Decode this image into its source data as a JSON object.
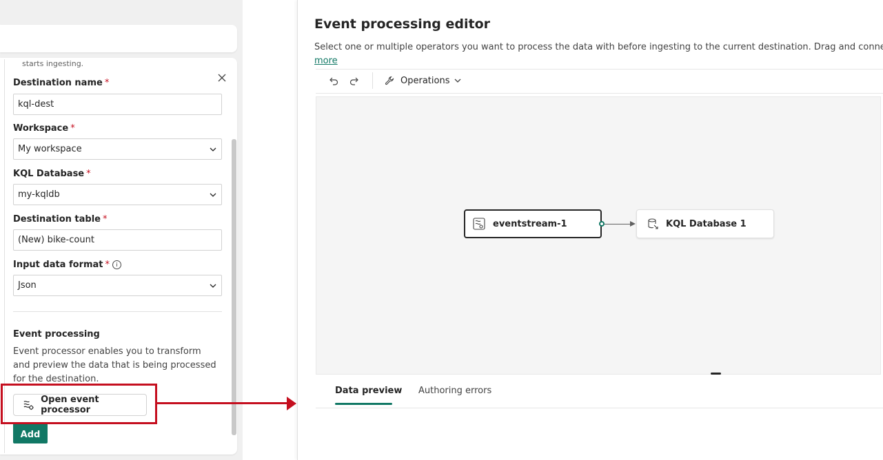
{
  "left_panel": {
    "ingest_text": "starts ingesting.",
    "fields": [
      {
        "label": "Destination name",
        "required": "*",
        "value": "kql-dest"
      },
      {
        "label": "Workspace",
        "required": "*",
        "value": "My workspace"
      },
      {
        "label": "KQL Database",
        "required": "*",
        "value": "my-kqldb"
      },
      {
        "label": "Destination table",
        "required": "*",
        "value": "(New) bike-count"
      },
      {
        "label": "Input data format",
        "required": "*",
        "value": "Json"
      }
    ],
    "info_glyph": "i",
    "event_processing": {
      "title": "Event processing",
      "description": "Event processor enables you to transform and preview the data that is being processed for the destination."
    },
    "open_button_label": "Open event processor",
    "add_button_label": "Add"
  },
  "editor": {
    "title": "Event processing editor",
    "description": "Select one or multiple operators you want to process the data with before ingesting to the current destination. Drag and connect the o",
    "more_link": "more",
    "toolbar": {
      "operations_label": "Operations"
    },
    "nodes": {
      "source": "eventstream-1",
      "destination": "KQL Database 1"
    },
    "tabs": [
      {
        "label": "Data preview",
        "active": true
      },
      {
        "label": "Authoring errors",
        "active": false
      }
    ]
  },
  "colors": {
    "accent": "#117865",
    "highlight": "#c50f1f"
  }
}
